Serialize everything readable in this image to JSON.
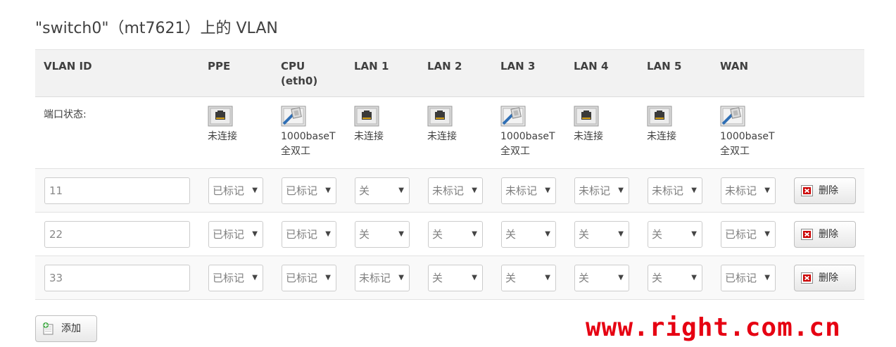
{
  "title": "\"switch0\"（mt7621）上的 VLAN",
  "headers": [
    "VLAN ID",
    "PPE",
    "CPU\n(eth0)",
    "LAN 1",
    "LAN 2",
    "LAN 3",
    "LAN 4",
    "LAN 5",
    "WAN"
  ],
  "status_label": "端口状态:",
  "ports": [
    {
      "name": "PPE",
      "connected": false,
      "text": "未连接",
      "icon": "port-disconnected-icon"
    },
    {
      "name": "CPU (eth0)",
      "connected": true,
      "text": "1000baseT\n全双工",
      "icon": "port-connected-icon"
    },
    {
      "name": "LAN 1",
      "connected": false,
      "text": "未连接",
      "icon": "port-disconnected-icon"
    },
    {
      "name": "LAN 2",
      "connected": false,
      "text": "未连接",
      "icon": "port-disconnected-icon"
    },
    {
      "name": "LAN 3",
      "connected": true,
      "text": "1000baseT\n全双工",
      "icon": "port-connected-icon"
    },
    {
      "name": "LAN 4",
      "connected": false,
      "text": "未连接",
      "icon": "port-disconnected-icon"
    },
    {
      "name": "LAN 5",
      "connected": false,
      "text": "未连接",
      "icon": "port-disconnected-icon"
    },
    {
      "name": "WAN",
      "connected": true,
      "text": "1000baseT\n全双工",
      "icon": "port-connected-icon"
    }
  ],
  "vlans": [
    {
      "id": "11",
      "ports": [
        "已标记",
        "已标记",
        "关",
        "未标记",
        "未标记",
        "未标记",
        "未标记",
        "未标记"
      ]
    },
    {
      "id": "22",
      "ports": [
        "已标记",
        "已标记",
        "关",
        "关",
        "关",
        "关",
        "关",
        "已标记"
      ]
    },
    {
      "id": "33",
      "ports": [
        "已标记",
        "已标记",
        "未标记",
        "关",
        "关",
        "关",
        "关",
        "已标记"
      ]
    }
  ],
  "delete_label": "删除",
  "add_label": "添加",
  "watermark": "www.right.com.cn",
  "colors": {
    "watermark": "#e60012",
    "delete_icon": "#cc0000",
    "add_icon": "#4caf50",
    "connected_plug": "#2f6fb5"
  }
}
